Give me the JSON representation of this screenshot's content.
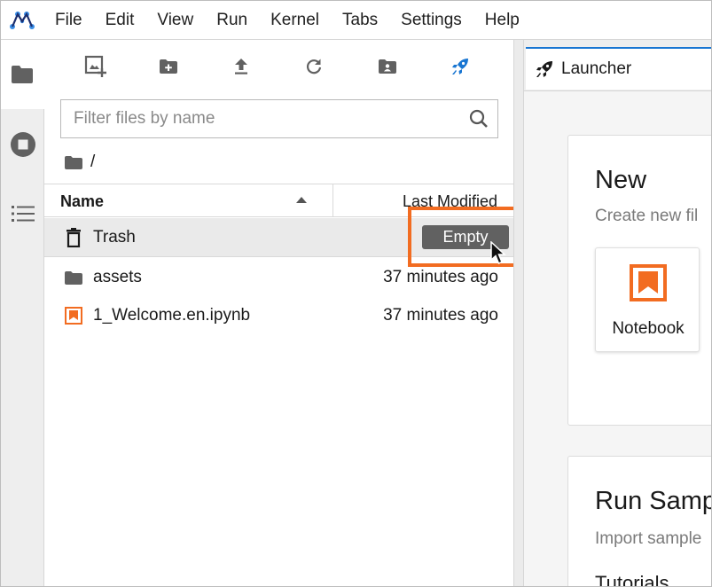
{
  "menubar": {
    "items": [
      "File",
      "Edit",
      "View",
      "Run",
      "Kernel",
      "Tabs",
      "Settings",
      "Help"
    ]
  },
  "activity": {
    "icons": [
      "folder-icon",
      "stop-circle-icon",
      "list-icon"
    ]
  },
  "filebrowser": {
    "toolbar_icons": [
      "new-launcher-icon",
      "new-folder-icon",
      "upload-icon",
      "refresh-icon",
      "shared-folder-icon",
      "rocket-icon"
    ],
    "filter_placeholder": "Filter files by name",
    "breadcrumb": "/",
    "columns": {
      "name": "Name",
      "modified": "Last Modified"
    },
    "rows": [
      {
        "name": "Trash",
        "modified": "",
        "type": "trash",
        "action": "Empty"
      },
      {
        "name": "assets",
        "modified": "37 minutes ago",
        "type": "folder"
      },
      {
        "name": "1_Welcome.en.ipynb",
        "modified": "37 minutes ago",
        "type": "notebook"
      }
    ]
  },
  "main": {
    "tab_label": "Launcher",
    "new_section": {
      "title": "New",
      "subtitle": "Create new fil"
    },
    "notebook_tile": {
      "label": "Notebook"
    },
    "run_section": {
      "title": "Run Samp",
      "subtitle": "Import sample",
      "sub_heading": "Tutorials"
    }
  },
  "colors": {
    "accent": "#f26c21",
    "tab_accent": "#1976d2",
    "empty_button": "#616161",
    "selected_row": "#eaeaea"
  }
}
